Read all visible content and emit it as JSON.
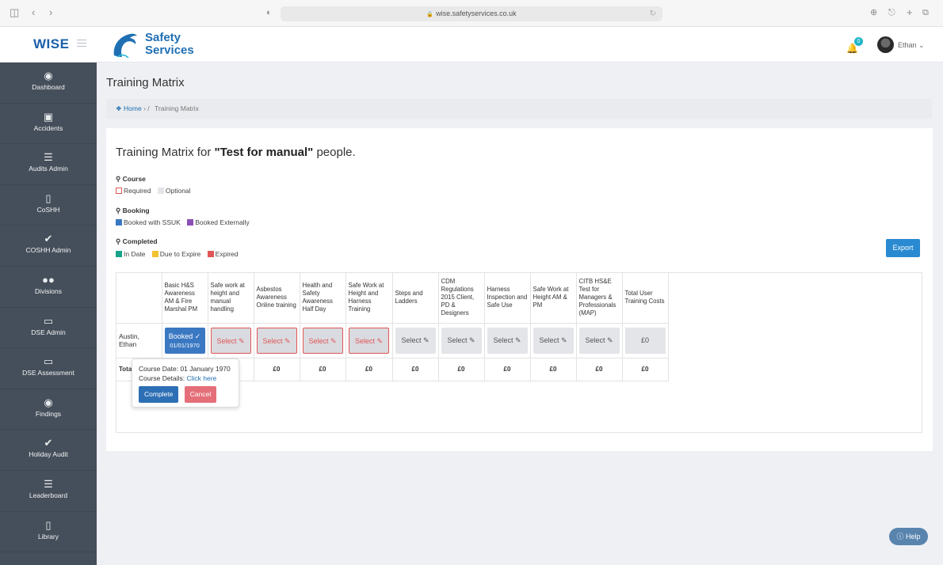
{
  "browser": {
    "url": "wise.safetyservices.co.uk"
  },
  "header": {
    "wise_logo": "WISE",
    "brand_line1": "Safety",
    "brand_line2": "Services",
    "notification_count": "0",
    "user_name": "Ethan"
  },
  "sidebar": {
    "items": [
      {
        "label": "Dashboard",
        "icon": "dashboard-icon"
      },
      {
        "label": "Accidents",
        "icon": "first-aid-icon"
      },
      {
        "label": "Audits Admin",
        "icon": "list-icon"
      },
      {
        "label": "CoSHH",
        "icon": "book-icon"
      },
      {
        "label": "COSHH Admin",
        "icon": "check-icon"
      },
      {
        "label": "Divisions",
        "icon": "users-icon"
      },
      {
        "label": "DSE Admin",
        "icon": "monitor-icon"
      },
      {
        "label": "DSE Assessment",
        "icon": "monitor-icon"
      },
      {
        "label": "Findings",
        "icon": "eye-icon"
      },
      {
        "label": "Holiday Audit",
        "icon": "check-icon"
      },
      {
        "label": "Leaderboard",
        "icon": "list-icon"
      },
      {
        "label": "Library",
        "icon": "book-icon"
      }
    ]
  },
  "page": {
    "title": "Training Matrix",
    "breadcrumb_home": "Home",
    "breadcrumb_sep": "/",
    "breadcrumb_current": "Training Matrix",
    "heading_prefix": "Training Matrix for ",
    "heading_group": "\"Test for manual\"",
    "heading_suffix": " people."
  },
  "legend": {
    "course_title": "Course",
    "required": "Required",
    "optional": "Optional",
    "booking_title": "Booking",
    "booked_ssuk": "Booked with SSUK",
    "booked_external": "Booked Externally",
    "completed_title": "Completed",
    "in_date": "In Date",
    "due_to_expire": "Due to Expire",
    "expired": "Expired"
  },
  "colors": {
    "required": "#e05656",
    "optional": "#e3e5e9",
    "booked_ssuk": "#3a78c2",
    "booked_external": "#8a4fb5",
    "in_date": "#17a38a",
    "due_to_expire": "#f2c230",
    "expired": "#e05656"
  },
  "export_label": "Export",
  "table": {
    "columns": [
      "Basic H&S Awareness AM & Fire Marshal PM",
      "Safe work at height and manual handling",
      "Asbestos Awareness Online training",
      "Health and Safety Awareness Half Day",
      "Safe Work at Height and Harness Training",
      "Steps and Ladders",
      "CDM Regulations 2015 Client, PD & Designers",
      "Harness Inspection and Safe Use",
      "Safe Work at Height AM & PM",
      "CITB HS&E Test for Managers & Professionals (MAP)",
      "Total User Training Costs"
    ],
    "row": {
      "name": "Austin, Ethan",
      "booked_label": "Booked",
      "booked_date": "01/01/1970",
      "select_label": "Select",
      "cost": "£0"
    },
    "total_label": "Total",
    "totals": [
      "£0",
      "£0",
      "£0",
      "£0",
      "£0",
      "£0",
      "£0",
      "£0",
      "£0"
    ]
  },
  "popover": {
    "date_label": "Course Date: 01 January 1970",
    "details_label": "Course Details: ",
    "details_link": "Click here",
    "complete": "Complete",
    "cancel": "Cancel"
  },
  "help_label": "Help"
}
